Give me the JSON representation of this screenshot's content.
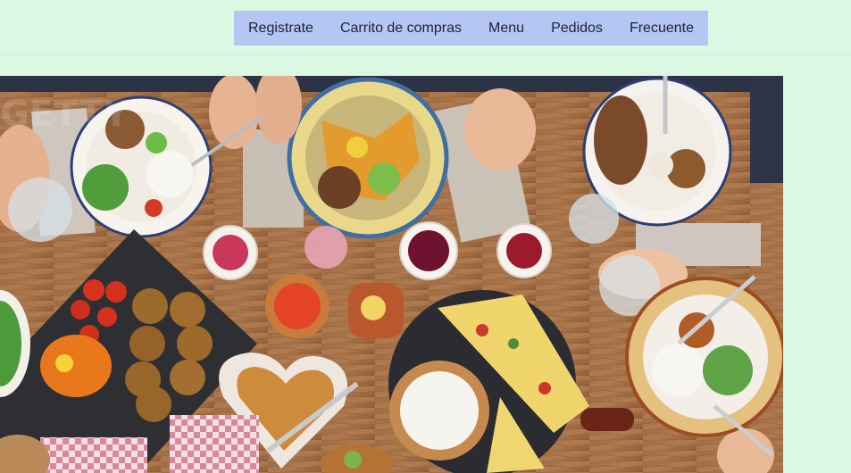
{
  "nav": {
    "items": [
      {
        "label": "Registrate"
      },
      {
        "label": "Carrito de compras"
      },
      {
        "label": "Menu"
      },
      {
        "label": "Pedidos"
      },
      {
        "label": "Frecuente"
      }
    ]
  },
  "hero": {
    "icon": "food-table-photo",
    "watermark": "GETTY"
  },
  "colors": {
    "background": "#dbf8e3",
    "nav_background": "#b3c6f4",
    "text": "#1f2230"
  }
}
